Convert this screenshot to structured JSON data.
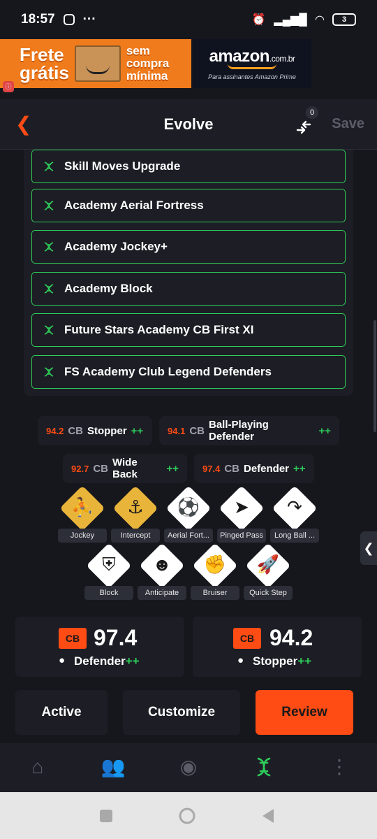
{
  "status_bar": {
    "time": "18:57",
    "battery": "3"
  },
  "ad": {
    "frete": "Frete",
    "gratis": "grátis",
    "sem": "sem",
    "compra": "compra",
    "minima": "mínima",
    "amazon": "amazon",
    "amazon_domain": ".com.br",
    "prime_text": "Para assinantes Amazon Prime"
  },
  "header": {
    "title": "Evolve",
    "compare_count": "0",
    "save_label": "Save"
  },
  "evolutions": [
    {
      "name": "Skill Moves Upgrade"
    },
    {
      "name": "Academy Aerial Fortress"
    },
    {
      "name": "Academy Jockey+"
    },
    {
      "name": "Academy Block"
    },
    {
      "name": "Future Stars Academy CB First XI"
    },
    {
      "name": "FS Academy Club Legend Defenders"
    }
  ],
  "roles": [
    {
      "rating": "94.2",
      "pos": "CB",
      "role": "Stopper",
      "plus": "++"
    },
    {
      "rating": "94.1",
      "pos": "CB",
      "role": "Ball-Playing Defender",
      "plus": "++"
    },
    {
      "rating": "92.7",
      "pos": "CB",
      "role": "Wide Back",
      "plus": "++"
    },
    {
      "rating": "97.4",
      "pos": "CB",
      "role": "Defender",
      "plus": "++"
    }
  ],
  "playstyles": [
    {
      "label": "Jockey",
      "icon": "jockey-icon",
      "tier": "plus"
    },
    {
      "label": "Intercept",
      "icon": "intercept-icon",
      "tier": "plus"
    },
    {
      "label": "Aerial Fort...",
      "icon": "aerial-fortress-icon",
      "tier": "base"
    },
    {
      "label": "Pinged Pass",
      "icon": "pinged-pass-icon",
      "tier": "base"
    },
    {
      "label": "Long Ball ...",
      "icon": "long-ball-pass-icon",
      "tier": "base"
    },
    {
      "label": "Block",
      "icon": "block-icon",
      "tier": "base"
    },
    {
      "label": "Anticipate",
      "icon": "anticipate-icon",
      "tier": "base"
    },
    {
      "label": "Bruiser",
      "icon": "bruiser-icon",
      "tier": "base"
    },
    {
      "label": "Quick Step",
      "icon": "quick-step-icon",
      "tier": "base"
    }
  ],
  "rating_cards": [
    {
      "pos": "CB",
      "value": "97.4",
      "role": "Defender",
      "plus": "++"
    },
    {
      "pos": "CB",
      "value": "94.2",
      "role": "Stopper",
      "plus": "++"
    }
  ],
  "actions": {
    "active": "Active",
    "customize": "Customize",
    "review": "Review"
  },
  "colors": {
    "accent": "#ff4b14",
    "green": "#2ecc5a",
    "gold": "#e8b43a",
    "background": "#16171d",
    "panel": "#1d1e25"
  }
}
